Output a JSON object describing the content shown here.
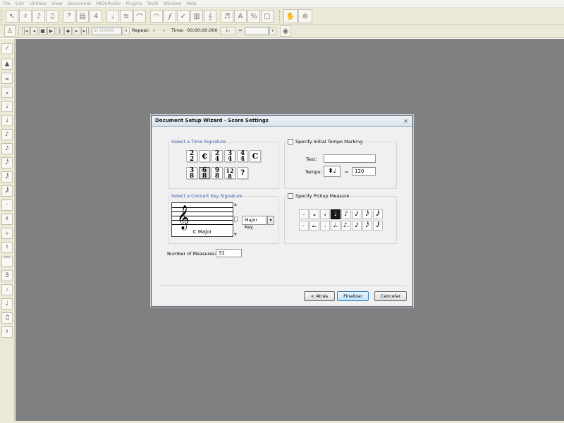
{
  "menu": [
    "File",
    "Edit",
    "Utilities",
    "View",
    "Document",
    "MIDI/Audio",
    "Plugins",
    "Tools",
    "Window",
    "Help"
  ],
  "toolbar": {
    "repeat_label": "Repeat:",
    "time_label": "Time:",
    "time_value": "00:00:00.000",
    "measure_value": "1| 1|0000"
  },
  "dialog": {
    "title": "Document Setup Wizard - Score Settings",
    "close": "×",
    "time_signature": {
      "label": "Select a Time Signature",
      "row1": [
        [
          "2",
          "2"
        ],
        [
          "C/"
        ],
        [
          "2",
          "4"
        ],
        [
          "3",
          "4"
        ],
        [
          "4",
          "4"
        ],
        [
          "C"
        ]
      ],
      "row2": [
        [
          "3",
          "8"
        ],
        [
          "6",
          "8"
        ],
        [
          "9",
          "8"
        ],
        [
          "12",
          "8"
        ],
        [
          "?"
        ]
      ]
    },
    "key_signature": {
      "label": "Select a Concert Key Signature",
      "key_name": "C Major",
      "mode": "Major Key"
    },
    "tempo": {
      "label": "Specify Initial Tempo Marking",
      "text_label": "Text:",
      "text_value": "",
      "tempo_label": "Tempo:",
      "equals": "=",
      "bpm": "120"
    },
    "pickup": {
      "label": "Specify Pickup Measure"
    },
    "measures": {
      "label": "Number of Measures:",
      "value": "31"
    },
    "buttons": {
      "back": "< Atrás",
      "finish": "Finalizar",
      "cancel": "Cancelar"
    }
  }
}
